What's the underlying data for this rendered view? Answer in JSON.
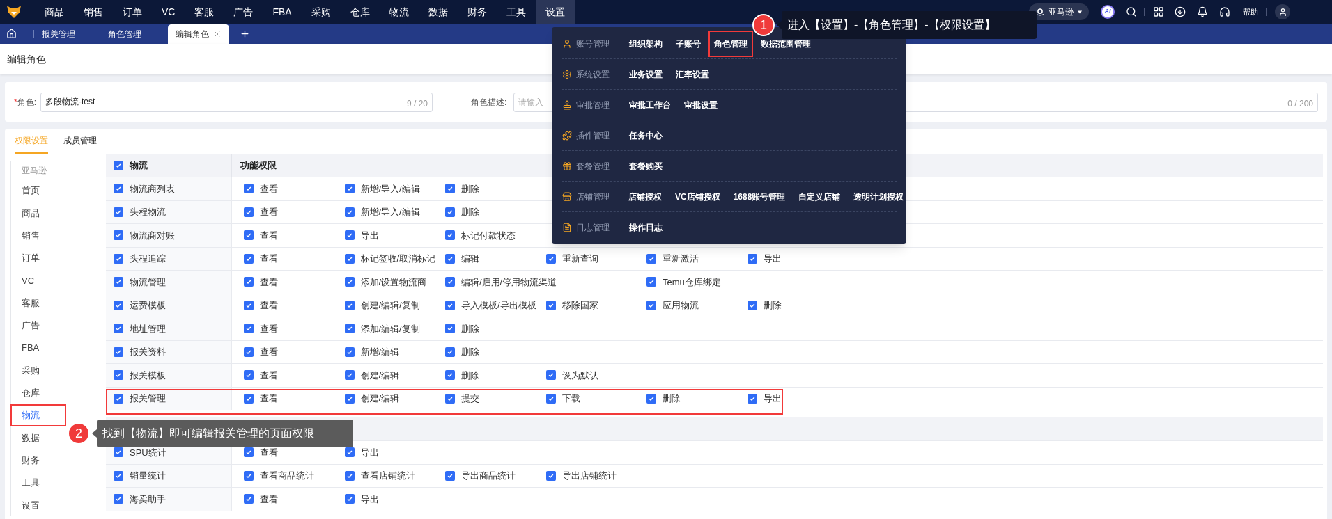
{
  "nav": {
    "items": [
      {
        "label": "商品",
        "selected": false
      },
      {
        "label": "销售",
        "selected": false
      },
      {
        "label": "订单",
        "selected": false
      },
      {
        "label": "VC",
        "selected": false
      },
      {
        "label": "客服",
        "selected": false
      },
      {
        "label": "广告",
        "selected": false
      },
      {
        "label": "FBA",
        "selected": false
      },
      {
        "label": "采购",
        "selected": false
      },
      {
        "label": "仓库",
        "selected": false
      },
      {
        "label": "物流",
        "selected": false
      },
      {
        "label": "数据",
        "selected": false
      },
      {
        "label": "财务",
        "selected": false
      },
      {
        "label": "工具",
        "selected": false
      },
      {
        "label": "设置",
        "selected": true
      }
    ],
    "platform": "亚马逊",
    "ai": "AI",
    "help": "帮助"
  },
  "tabs": [
    {
      "label": "报关管理",
      "selected": false
    },
    {
      "label": "角色管理",
      "selected": false
    },
    {
      "label": "编辑角色",
      "selected": true
    }
  ],
  "page_title": "编辑角色",
  "role": {
    "required_mark": "*",
    "label": "角色:",
    "value": "多段物流-test",
    "count": "9 / 20"
  },
  "description": {
    "label": "角色描述:",
    "placeholder": "请输入",
    "count": "0 / 200"
  },
  "card_tabs": [
    {
      "label": "权限设置",
      "selected": true
    },
    {
      "label": "成员管理",
      "selected": false
    }
  ],
  "sidebar": {
    "group": "亚马逊",
    "items": [
      {
        "label": "首页",
        "selected": false,
        "highlighted": false
      },
      {
        "label": "商品",
        "selected": false,
        "highlighted": false
      },
      {
        "label": "销售",
        "selected": false,
        "highlighted": false
      },
      {
        "label": "订单",
        "selected": false,
        "highlighted": false
      },
      {
        "label": "VC",
        "selected": false,
        "highlighted": false
      },
      {
        "label": "客服",
        "selected": false,
        "highlighted": false
      },
      {
        "label": "广告",
        "selected": false,
        "highlighted": false
      },
      {
        "label": "FBA",
        "selected": false,
        "highlighted": false
      },
      {
        "label": "采购",
        "selected": false,
        "highlighted": false
      },
      {
        "label": "仓库",
        "selected": false,
        "highlighted": false
      },
      {
        "label": "物流",
        "selected": true,
        "highlighted": true
      },
      {
        "label": "数据",
        "selected": false,
        "highlighted": false
      },
      {
        "label": "财务",
        "selected": false,
        "highlighted": false
      },
      {
        "label": "工具",
        "selected": false,
        "highlighted": false
      },
      {
        "label": "设置",
        "selected": false,
        "highlighted": false
      }
    ]
  },
  "table": {
    "sections": [
      {
        "header": {
          "name": "物流",
          "checked": true,
          "column": "功能权限"
        },
        "rows": [
          {
            "name": "物流商列表",
            "checked": true,
            "highlighted": false,
            "perms": [
              {
                "label": "查看",
                "checked": true
              },
              {
                "label": "新增/导入/编辑",
                "checked": true
              },
              {
                "label": "删除",
                "checked": true
              }
            ]
          },
          {
            "name": "头程物流",
            "checked": true,
            "highlighted": false,
            "perms": [
              {
                "label": "查看",
                "checked": true
              },
              {
                "label": "新增/导入/编辑",
                "checked": true
              },
              {
                "label": "删除",
                "checked": true
              }
            ]
          },
          {
            "name": "物流商对账",
            "checked": true,
            "highlighted": false,
            "perms": [
              {
                "label": "查看",
                "checked": true
              },
              {
                "label": "导出",
                "checked": true
              },
              {
                "label": "标记付款状态",
                "checked": true
              }
            ]
          },
          {
            "name": "头程追踪",
            "checked": true,
            "highlighted": false,
            "perms": [
              {
                "label": "查看",
                "checked": true
              },
              {
                "label": "标记签收/取消标记",
                "checked": true
              },
              {
                "label": "编辑",
                "checked": true
              },
              {
                "label": "重新查询",
                "checked": true
              },
              {
                "label": "重新激活",
                "checked": true
              },
              {
                "label": "导出",
                "checked": true
              }
            ]
          },
          {
            "name": "物流管理",
            "checked": true,
            "highlighted": false,
            "perms": [
              {
                "label": "查看",
                "checked": true
              },
              {
                "label": "添加/设置物流商",
                "checked": true
              },
              {
                "label": "编辑/启用/停用物流渠道",
                "checked": true
              },
              {
                "label": "Temu仓库绑定",
                "checked": true,
                "gap_before": true
              }
            ]
          },
          {
            "name": "运费模板",
            "checked": true,
            "highlighted": false,
            "perms": [
              {
                "label": "查看",
                "checked": true
              },
              {
                "label": "创建/编辑/复制",
                "checked": true
              },
              {
                "label": "导入模板/导出模板",
                "checked": true
              },
              {
                "label": "移除国家",
                "checked": true
              },
              {
                "label": "应用物流",
                "checked": true
              },
              {
                "label": "删除",
                "checked": true
              }
            ]
          },
          {
            "name": "地址管理",
            "checked": true,
            "highlighted": false,
            "perms": [
              {
                "label": "查看",
                "checked": true
              },
              {
                "label": "添加/编辑/复制",
                "checked": true
              },
              {
                "label": "删除",
                "checked": true
              }
            ]
          },
          {
            "name": "报关资料",
            "checked": true,
            "highlighted": false,
            "perms": [
              {
                "label": "查看",
                "checked": true
              },
              {
                "label": "新增/编辑",
                "checked": true
              },
              {
                "label": "删除",
                "checked": true
              }
            ]
          },
          {
            "name": "报关模板",
            "checked": true,
            "highlighted": false,
            "perms": [
              {
                "label": "查看",
                "checked": true
              },
              {
                "label": "创建/编辑",
                "checked": true
              },
              {
                "label": "删除",
                "checked": true
              },
              {
                "label": "设为默认",
                "checked": true
              }
            ]
          },
          {
            "name": "报关管理",
            "checked": true,
            "highlighted": true,
            "perms": [
              {
                "label": "查看",
                "checked": true
              },
              {
                "label": "创建/编辑",
                "checked": true
              },
              {
                "label": "提交",
                "checked": true
              },
              {
                "label": "下载",
                "checked": true
              },
              {
                "label": "删除",
                "checked": true
              },
              {
                "label": "导出",
                "checked": true
              }
            ]
          }
        ]
      },
      {
        "rows": [
          {
            "name": "SPU统计",
            "checked": true,
            "highlighted": false,
            "perms": [
              {
                "label": "查看",
                "checked": true
              },
              {
                "label": "导出",
                "checked": true
              }
            ]
          },
          {
            "name": "销量统计",
            "checked": true,
            "highlighted": false,
            "perms": [
              {
                "label": "查看商品统计",
                "checked": true
              },
              {
                "label": "查看店铺统计",
                "checked": true
              },
              {
                "label": "导出商品统计",
                "checked": true
              },
              {
                "label": "导出店铺统计",
                "checked": true
              }
            ]
          },
          {
            "name": "海卖助手",
            "checked": true,
            "highlighted": false,
            "perms": [
              {
                "label": "查看",
                "checked": true
              },
              {
                "label": "导出",
                "checked": true
              }
            ]
          }
        ]
      }
    ]
  },
  "settings_menu": [
    {
      "group": "账号管理",
      "items": [
        {
          "label": "组织架构",
          "highlighted": false
        },
        {
          "label": "子账号",
          "highlighted": false
        },
        {
          "label": "角色管理",
          "highlighted": true
        },
        {
          "label": "数据范围管理",
          "highlighted": false
        }
      ]
    },
    {
      "group": "系统设置",
      "items": [
        {
          "label": "业务设置",
          "highlighted": false
        },
        {
          "label": "汇率设置",
          "highlighted": false
        }
      ]
    },
    {
      "group": "审批管理",
      "items": [
        {
          "label": "审批工作台",
          "highlighted": false
        },
        {
          "label": "审批设置",
          "highlighted": false
        }
      ]
    },
    {
      "group": "插件管理",
      "items": [
        {
          "label": "任务中心",
          "highlighted": false
        }
      ]
    },
    {
      "group": "套餐管理",
      "items": [
        {
          "label": "套餐购买",
          "highlighted": false
        }
      ]
    },
    {
      "group": "店铺管理",
      "items": [
        {
          "label": "店铺授权",
          "highlighted": false
        },
        {
          "label": "VC店铺授权",
          "highlighted": false
        },
        {
          "label": "1688账号管理",
          "highlighted": false
        },
        {
          "label": "自定义店铺",
          "highlighted": false
        },
        {
          "label": "透明计划授权",
          "highlighted": false
        }
      ]
    },
    {
      "group": "日志管理",
      "items": [
        {
          "label": "操作日志",
          "highlighted": false
        }
      ]
    }
  ],
  "callouts": [
    {
      "number": "1",
      "text": "进入【设置】-【角色管理】-【权限设置】"
    },
    {
      "number": "2",
      "text": "找到【物流】即可编辑报关管理的页面权限"
    }
  ]
}
